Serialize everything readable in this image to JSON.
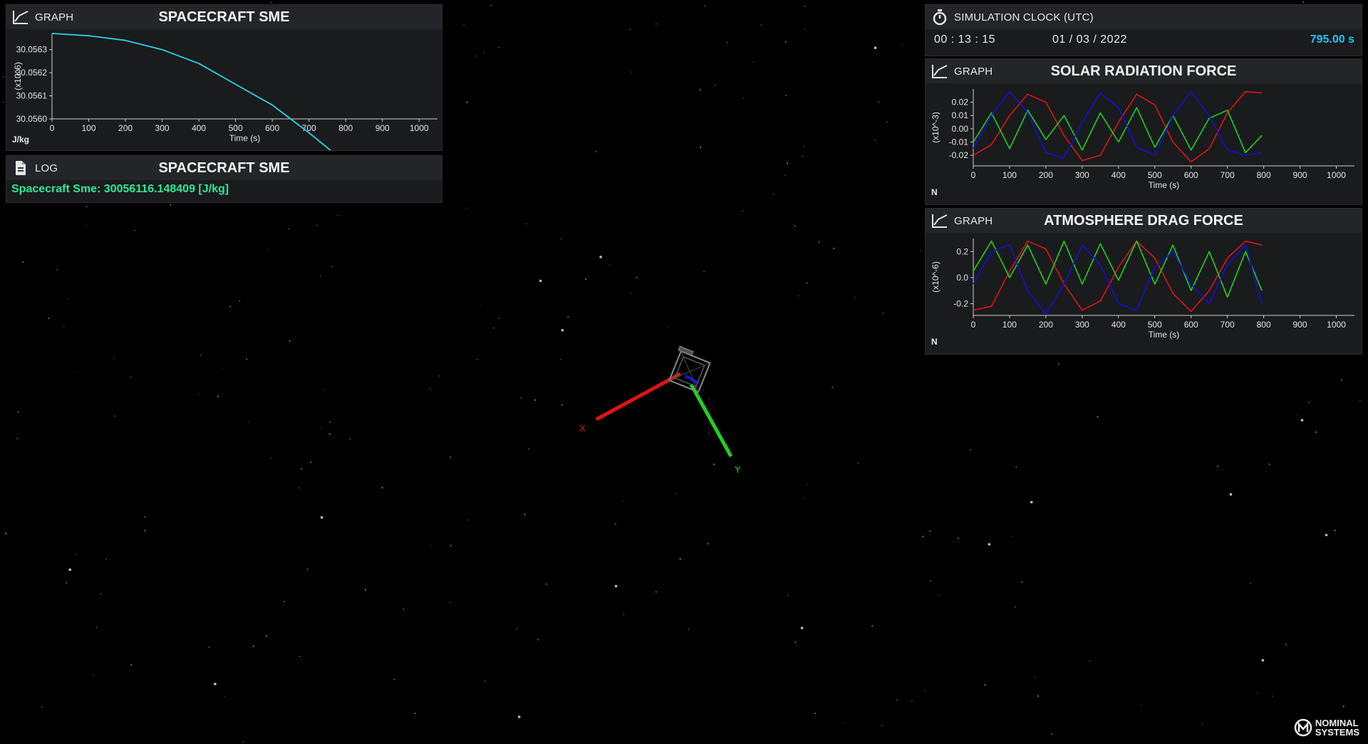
{
  "colors": {
    "series_x": "#e01414",
    "series_y": "#1ed21e",
    "series_z": "#1010dc",
    "sme_line": "#2ad3e6",
    "log_text": "#2ee89a",
    "clock_elapsed": "#23c4f2"
  },
  "sme_graph": {
    "kind_label": "GRAPH",
    "icon": "line-chart-icon",
    "title": "SPACECRAFT SME",
    "unit": "J/kg",
    "chart_data": {
      "type": "line",
      "title": "SPACECRAFT SME",
      "xlabel": "Time (s)",
      "ylabel": "(x10^6)",
      "xlim": [
        0,
        1050
      ],
      "ylim": [
        30.056,
        30.05637
      ],
      "xticks": [
        0,
        100,
        200,
        300,
        400,
        500,
        600,
        700,
        800,
        900,
        1000
      ],
      "yticks": [
        30.056,
        30.0561,
        30.0562,
        30.0563
      ],
      "ytick_labels": [
        "30.0560",
        "30.0561",
        "30.0562",
        "30.0563"
      ],
      "series": [
        {
          "x": [
            0,
            100,
            200,
            300,
            400,
            500,
            600,
            700,
            800
          ],
          "y": [
            30.05637,
            30.05636,
            30.05634,
            30.0563,
            30.05624,
            30.05615,
            30.05606,
            30.05594,
            30.05581
          ]
        }
      ]
    }
  },
  "sme_log": {
    "kind_label": "LOG",
    "icon": "document-icon",
    "title": "SPACECRAFT SME",
    "line": "Spacecraft Sme: 30056116.148409 [J/kg]"
  },
  "clock": {
    "icon": "stopwatch-icon",
    "title": "SIMULATION CLOCK (UTC)",
    "time": "00 : 13 : 15",
    "date": "01 / 03 / 2022",
    "elapsed": "795.00 s"
  },
  "solar_graph": {
    "kind_label": "GRAPH",
    "icon": "line-chart-icon",
    "title": "SOLAR RADIATION FORCE",
    "unit": "N",
    "chart_data": {
      "type": "line",
      "title": "SOLAR RADIATION FORCE",
      "xlabel": "Time (s)",
      "ylabel": "(x10^-3)",
      "xlim": [
        0,
        1050
      ],
      "ylim": [
        -0.028,
        0.03
      ],
      "xticks": [
        0,
        100,
        200,
        300,
        400,
        500,
        600,
        700,
        800,
        900,
        1000
      ],
      "yticks": [
        0.02,
        0.01,
        0.0,
        -0.01,
        -0.02
      ],
      "ytick_labels": [
        "0.02",
        "0.01",
        "0.00",
        "-0.01",
        "-0.02"
      ],
      "x": [
        0,
        50,
        100,
        150,
        200,
        250,
        300,
        350,
        400,
        450,
        500,
        550,
        600,
        650,
        700,
        750,
        795
      ],
      "series": [
        {
          "color": "red",
          "values": [
            -0.02,
            -0.012,
            0.01,
            0.026,
            0.02,
            -0.005,
            -0.024,
            -0.02,
            0.005,
            0.026,
            0.018,
            -0.01,
            -0.025,
            -0.015,
            0.012,
            0.028,
            0.027
          ]
        },
        {
          "color": "green",
          "values": [
            -0.01,
            0.012,
            -0.015,
            0.014,
            -0.008,
            0.01,
            -0.016,
            0.012,
            -0.01,
            0.016,
            -0.014,
            0.01,
            -0.016,
            0.008,
            0.014,
            -0.018,
            -0.005
          ]
        },
        {
          "color": "blue",
          "values": [
            -0.015,
            0.01,
            0.028,
            0.012,
            -0.018,
            -0.022,
            0.005,
            0.027,
            0.016,
            -0.014,
            -0.02,
            0.01,
            0.028,
            0.01,
            -0.016,
            -0.02,
            -0.018
          ]
        }
      ]
    }
  },
  "drag_graph": {
    "kind_label": "GRAPH",
    "icon": "line-chart-icon",
    "title": "ATMOSPHERE DRAG FORCE",
    "unit": "N",
    "chart_data": {
      "type": "line",
      "title": "ATMOSPHERE DRAG FORCE",
      "xlabel": "Time (s)",
      "ylabel": "(x10^-6)",
      "xlim": [
        0,
        1050
      ],
      "ylim": [
        -0.29,
        0.3
      ],
      "xticks": [
        0,
        100,
        200,
        300,
        400,
        500,
        600,
        700,
        800,
        900,
        1000
      ],
      "yticks": [
        0.2,
        0.0,
        -0.2
      ],
      "ytick_labels": [
        "0.2",
        "0.0",
        "-0.2"
      ],
      "x": [
        0,
        50,
        100,
        150,
        200,
        250,
        300,
        350,
        400,
        450,
        500,
        550,
        600,
        650,
        700,
        750,
        795
      ],
      "series": [
        {
          "color": "red",
          "values": [
            -0.25,
            -0.22,
            0.05,
            0.28,
            0.22,
            -0.05,
            -0.25,
            -0.18,
            0.08,
            0.28,
            0.15,
            -0.12,
            -0.26,
            -0.1,
            0.15,
            0.28,
            0.25
          ]
        },
        {
          "color": "green",
          "values": [
            0.05,
            0.28,
            0.0,
            0.25,
            -0.05,
            0.28,
            -0.05,
            0.26,
            -0.02,
            0.28,
            -0.05,
            0.25,
            -0.1,
            0.2,
            -0.15,
            0.2,
            -0.1
          ]
        },
        {
          "color": "blue",
          "values": [
            -0.05,
            0.2,
            0.25,
            -0.1,
            -0.28,
            -0.05,
            0.25,
            0.1,
            -0.2,
            -0.25,
            0.08,
            0.2,
            -0.05,
            -0.2,
            0.1,
            0.25,
            -0.2
          ]
        }
      ]
    }
  },
  "scene": {
    "axis_x_label": "X",
    "axis_y_label": "Y"
  },
  "logo": {
    "icon": "nominal-systems-logo-icon",
    "line1": "NOMINAL",
    "line2": "SYSTEMS"
  }
}
